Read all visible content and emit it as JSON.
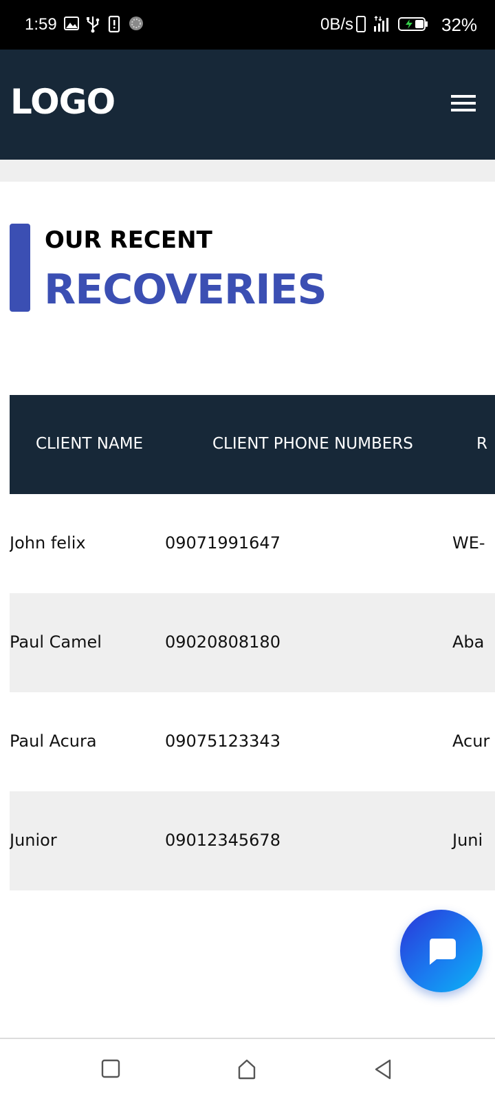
{
  "status_bar": {
    "time": "1:59",
    "network_speed": "0B/s",
    "battery_percent": "32%",
    "icons": [
      "image-icon",
      "usb-icon",
      "sim-alert-icon",
      "loading-icon",
      "phone-icon",
      "signal-icon",
      "battery-charging-icon"
    ]
  },
  "header": {
    "logo_text": "LOGO",
    "menu_icon": "hamburger-menu-icon"
  },
  "section": {
    "subtitle": "OUR RECENT",
    "title": "RECOVERIES"
  },
  "table": {
    "headers": [
      "CLIENT NAME",
      "CLIENT PHONE NUMBERS",
      "R"
    ],
    "rows": [
      {
        "name": "John felix",
        "phone": "09071991647",
        "third": "WE-"
      },
      {
        "name": "Paul Camel",
        "phone": "09020808180",
        "third": "Aba"
      },
      {
        "name": "Paul Acura",
        "phone": "09075123343",
        "third": "Acur"
      },
      {
        "name": "Junior",
        "phone": "09012345678",
        "third": "Juni"
      }
    ]
  },
  "chat_button": {
    "icon": "chat-bubble-icon"
  },
  "nav_bar": {
    "buttons": [
      "recents-square-icon",
      "home-icon",
      "back-triangle-icon"
    ]
  },
  "colors": {
    "header_bg": "#172838",
    "accent": "#3b4fb3",
    "alt_row": "#efefef",
    "fab_start": "#2a35d8",
    "fab_end": "#0bb6f5"
  }
}
